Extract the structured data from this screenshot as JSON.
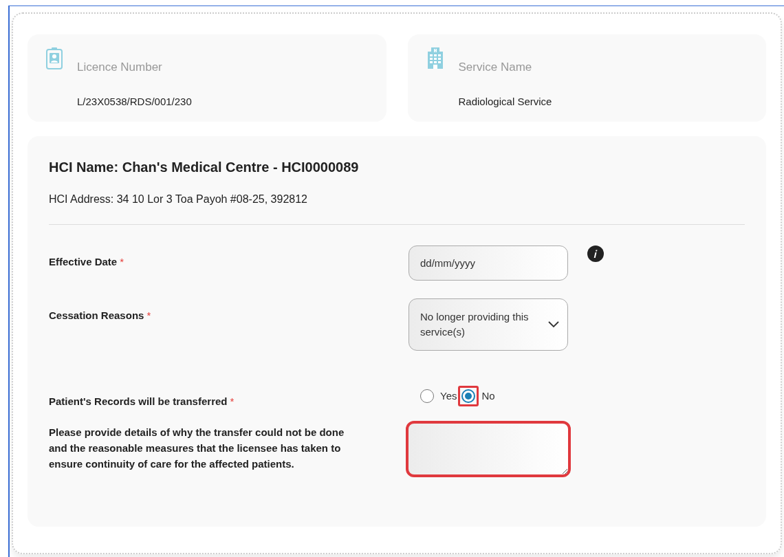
{
  "info_cards": [
    {
      "kind": "licence",
      "label": "Licence Number",
      "value": "L/23X0538/RDS/001/230"
    },
    {
      "kind": "service",
      "label": "Service Name",
      "value": "Radiological Service"
    }
  ],
  "hci": {
    "name": "HCI Name: Chan's Medical Centre - HCI0000089",
    "address": "HCI Address: 34 10 Lor 3 Toa Payoh #08-25, 392812"
  },
  "form": [
    {
      "kind": "date",
      "label": "Effective Date",
      "required_mark": "*",
      "placeholder": "dd/mm/yyyy",
      "info": true
    },
    {
      "kind": "select",
      "label": "Cessation Reasons",
      "required_mark": "*",
      "value": "No longer providing this service(s)"
    },
    {
      "kind": "radio",
      "label": "Patient's Records will be transferred",
      "required_mark": "*",
      "options": [
        {
          "label": "Yes",
          "selected": false,
          "highlighted": false
        },
        {
          "label": "No",
          "selected": true,
          "highlighted": true
        }
      ]
    },
    {
      "kind": "textarea",
      "label": "Please provide details of why the transfer could not be done and the reasonable measures that the licensee has taken to ensure continuity of care for the affected patients.",
      "highlighted": true
    }
  ]
}
